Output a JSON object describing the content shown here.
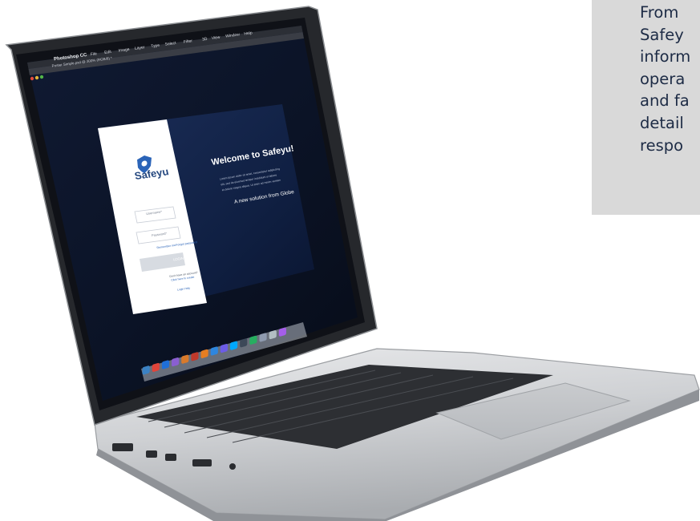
{
  "caption": {
    "text": "From\nSafey\ninform\nopera\nand fa\ndetail\nrespo"
  },
  "photoshop": {
    "apple_glyph": "",
    "app_name": "Photoshop CC",
    "menu": [
      "File",
      "Edit",
      "Image",
      "Layer",
      "Type",
      "Select",
      "Filter",
      "3D",
      "View",
      "Window",
      "Help"
    ],
    "document_tab": "Poster Simple.psd @ 300% (RGB/8) *"
  },
  "safeyu": {
    "logo_text": "Safeyu",
    "username_placeholder": "Username*",
    "password_placeholder": "Password*",
    "remember_label": "Remember me",
    "forgot_label": "Forgot password",
    "login_button": "LOGIN",
    "no_account": "Don't have an account?",
    "create_account": "Click here to create",
    "help_link": "Login Help",
    "welcome_title": "Welcome to Safeyu!",
    "welcome_body": [
      "Lorem ipsum dolor sit amet, consectetur adipiscing",
      "elit, sed do eiusmod tempor incididunt ut labore",
      "et dolore magna aliqua. Ut enim ad minim veniam"
    ],
    "tagline": "A new solution from Globe"
  },
  "dock": {
    "icon_colors": [
      "#3b82c4",
      "#e0443a",
      "#1f6fd8",
      "#8a5fd1",
      "#d97a2b",
      "#c0392b",
      "#e67e22",
      "#2e86de",
      "#6c5ce7",
      "#00a8ff",
      "#3c4858",
      "#27ae60",
      "#8e9aaf",
      "#b2bec3",
      "#a55eea"
    ]
  }
}
